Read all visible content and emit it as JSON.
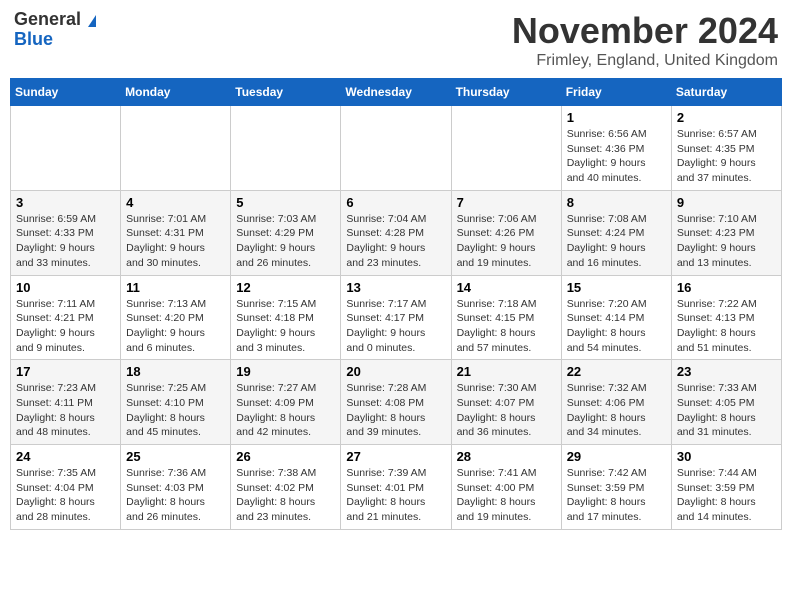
{
  "logo": {
    "general": "General",
    "blue": "Blue"
  },
  "header": {
    "month_title": "November 2024",
    "location": "Frimley, England, United Kingdom"
  },
  "weekdays": [
    "Sunday",
    "Monday",
    "Tuesday",
    "Wednesday",
    "Thursday",
    "Friday",
    "Saturday"
  ],
  "weeks": [
    [
      {
        "day": "",
        "info": ""
      },
      {
        "day": "",
        "info": ""
      },
      {
        "day": "",
        "info": ""
      },
      {
        "day": "",
        "info": ""
      },
      {
        "day": "",
        "info": ""
      },
      {
        "day": "1",
        "info": "Sunrise: 6:56 AM\nSunset: 4:36 PM\nDaylight: 9 hours and 40 minutes."
      },
      {
        "day": "2",
        "info": "Sunrise: 6:57 AM\nSunset: 4:35 PM\nDaylight: 9 hours and 37 minutes."
      }
    ],
    [
      {
        "day": "3",
        "info": "Sunrise: 6:59 AM\nSunset: 4:33 PM\nDaylight: 9 hours and 33 minutes."
      },
      {
        "day": "4",
        "info": "Sunrise: 7:01 AM\nSunset: 4:31 PM\nDaylight: 9 hours and 30 minutes."
      },
      {
        "day": "5",
        "info": "Sunrise: 7:03 AM\nSunset: 4:29 PM\nDaylight: 9 hours and 26 minutes."
      },
      {
        "day": "6",
        "info": "Sunrise: 7:04 AM\nSunset: 4:28 PM\nDaylight: 9 hours and 23 minutes."
      },
      {
        "day": "7",
        "info": "Sunrise: 7:06 AM\nSunset: 4:26 PM\nDaylight: 9 hours and 19 minutes."
      },
      {
        "day": "8",
        "info": "Sunrise: 7:08 AM\nSunset: 4:24 PM\nDaylight: 9 hours and 16 minutes."
      },
      {
        "day": "9",
        "info": "Sunrise: 7:10 AM\nSunset: 4:23 PM\nDaylight: 9 hours and 13 minutes."
      }
    ],
    [
      {
        "day": "10",
        "info": "Sunrise: 7:11 AM\nSunset: 4:21 PM\nDaylight: 9 hours and 9 minutes."
      },
      {
        "day": "11",
        "info": "Sunrise: 7:13 AM\nSunset: 4:20 PM\nDaylight: 9 hours and 6 minutes."
      },
      {
        "day": "12",
        "info": "Sunrise: 7:15 AM\nSunset: 4:18 PM\nDaylight: 9 hours and 3 minutes."
      },
      {
        "day": "13",
        "info": "Sunrise: 7:17 AM\nSunset: 4:17 PM\nDaylight: 9 hours and 0 minutes."
      },
      {
        "day": "14",
        "info": "Sunrise: 7:18 AM\nSunset: 4:15 PM\nDaylight: 8 hours and 57 minutes."
      },
      {
        "day": "15",
        "info": "Sunrise: 7:20 AM\nSunset: 4:14 PM\nDaylight: 8 hours and 54 minutes."
      },
      {
        "day": "16",
        "info": "Sunrise: 7:22 AM\nSunset: 4:13 PM\nDaylight: 8 hours and 51 minutes."
      }
    ],
    [
      {
        "day": "17",
        "info": "Sunrise: 7:23 AM\nSunset: 4:11 PM\nDaylight: 8 hours and 48 minutes."
      },
      {
        "day": "18",
        "info": "Sunrise: 7:25 AM\nSunset: 4:10 PM\nDaylight: 8 hours and 45 minutes."
      },
      {
        "day": "19",
        "info": "Sunrise: 7:27 AM\nSunset: 4:09 PM\nDaylight: 8 hours and 42 minutes."
      },
      {
        "day": "20",
        "info": "Sunrise: 7:28 AM\nSunset: 4:08 PM\nDaylight: 8 hours and 39 minutes."
      },
      {
        "day": "21",
        "info": "Sunrise: 7:30 AM\nSunset: 4:07 PM\nDaylight: 8 hours and 36 minutes."
      },
      {
        "day": "22",
        "info": "Sunrise: 7:32 AM\nSunset: 4:06 PM\nDaylight: 8 hours and 34 minutes."
      },
      {
        "day": "23",
        "info": "Sunrise: 7:33 AM\nSunset: 4:05 PM\nDaylight: 8 hours and 31 minutes."
      }
    ],
    [
      {
        "day": "24",
        "info": "Sunrise: 7:35 AM\nSunset: 4:04 PM\nDaylight: 8 hours and 28 minutes."
      },
      {
        "day": "25",
        "info": "Sunrise: 7:36 AM\nSunset: 4:03 PM\nDaylight: 8 hours and 26 minutes."
      },
      {
        "day": "26",
        "info": "Sunrise: 7:38 AM\nSunset: 4:02 PM\nDaylight: 8 hours and 23 minutes."
      },
      {
        "day": "27",
        "info": "Sunrise: 7:39 AM\nSunset: 4:01 PM\nDaylight: 8 hours and 21 minutes."
      },
      {
        "day": "28",
        "info": "Sunrise: 7:41 AM\nSunset: 4:00 PM\nDaylight: 8 hours and 19 minutes."
      },
      {
        "day": "29",
        "info": "Sunrise: 7:42 AM\nSunset: 3:59 PM\nDaylight: 8 hours and 17 minutes."
      },
      {
        "day": "30",
        "info": "Sunrise: 7:44 AM\nSunset: 3:59 PM\nDaylight: 8 hours and 14 minutes."
      }
    ]
  ]
}
